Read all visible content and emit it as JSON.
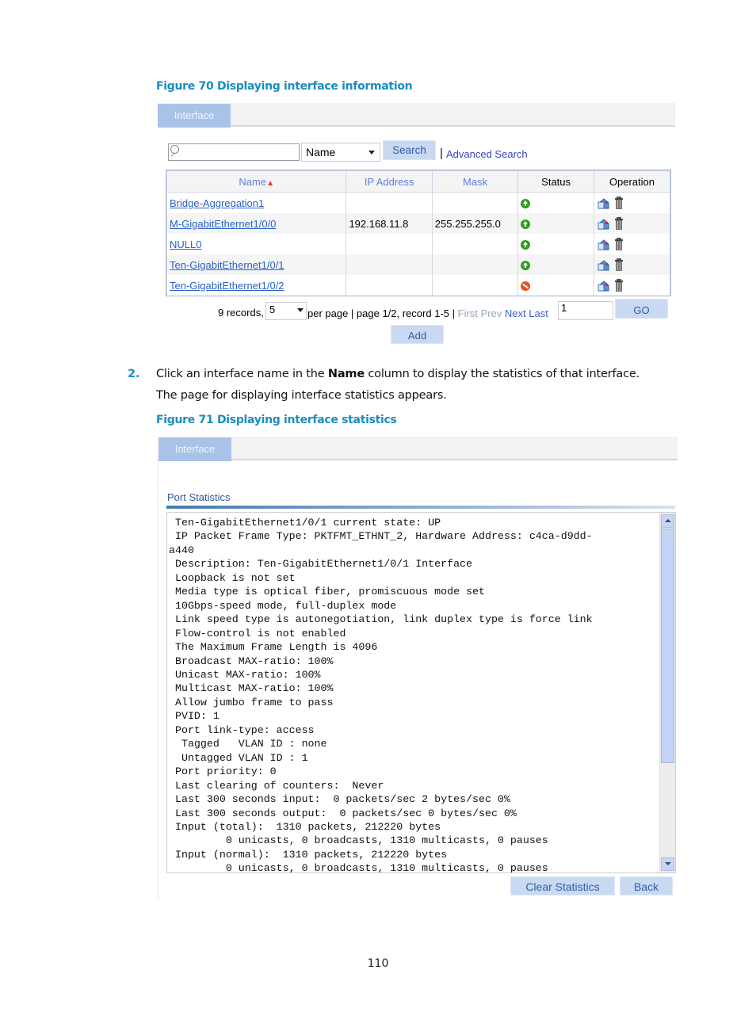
{
  "figure70": {
    "caption": "Figure 70 Displaying interface information",
    "tab_label": "Interface",
    "search": {
      "value": "",
      "placeholder": "",
      "field_selected": "Name",
      "search_label": "Search",
      "separator": "|",
      "advanced_label": "Advanced Search"
    },
    "table": {
      "columns": [
        {
          "label": "Name",
          "sort": "ascending"
        },
        {
          "label": "IP Address"
        },
        {
          "label": "Mask"
        },
        {
          "label": "Status"
        },
        {
          "label": "Operation"
        }
      ],
      "rows": [
        {
          "name": "Bridge-Aggregation1",
          "ip": "",
          "mask": "",
          "status": "up"
        },
        {
          "name": "M-GigabitEthernet1/0/0",
          "ip": "192.168.11.8",
          "mask": "255.255.255.0",
          "status": "up"
        },
        {
          "name": "NULL0",
          "ip": "",
          "mask": "",
          "status": "up"
        },
        {
          "name": "Ten-GigabitEthernet1/0/1",
          "ip": "",
          "mask": "",
          "status": "up"
        },
        {
          "name": "Ten-GigabitEthernet1/0/2",
          "ip": "",
          "mask": "",
          "status": "down"
        }
      ],
      "status_colors": {
        "up": "#2f9e1f",
        "down": "#e3541c"
      }
    },
    "pagination": {
      "records_text": "9 records,",
      "per_page_value": "5",
      "per_page_text": "per page | page 1/2, record 1-5 |",
      "first": "First",
      "prev": "Prev",
      "next": "Next",
      "last": "Last",
      "page_input": "1",
      "go_label": "GO"
    },
    "add_label": "Add"
  },
  "step": {
    "number": "2.",
    "text_before": "Click an interface name in the ",
    "text_bold": "Name",
    "text_after": " column to display the statistics of that interface.",
    "result": "The page for displaying interface statistics appears."
  },
  "figure71": {
    "caption": "Figure 71 Displaying interface statistics",
    "tab_label": "Interface",
    "section_title": "Port Statistics",
    "stats_lines": [
      " Ten-GigabitEthernet1/0/1 current state: UP",
      " IP Packet Frame Type: PKTFMT_ETHNT_2, Hardware Address: c4ca-d9dd-",
      "a440",
      " Description: Ten-GigabitEthernet1/0/1 Interface",
      " Loopback is not set",
      " Media type is optical fiber, promiscuous mode set",
      " 10Gbps-speed mode, full-duplex mode",
      " Link speed type is autonegotiation, link duplex type is force link",
      " Flow-control is not enabled",
      " The Maximum Frame Length is 4096",
      " Broadcast MAX-ratio: 100%",
      " Unicast MAX-ratio: 100%",
      " Multicast MAX-ratio: 100%",
      " Allow jumbo frame to pass",
      " PVID: 1",
      " Port link-type: access",
      "  Tagged   VLAN ID : none",
      "  Untagged VLAN ID : 1",
      " Port priority: 0",
      " Last clearing of counters:  Never",
      " Last 300 seconds input:  0 packets/sec 2 bytes/sec 0%",
      " Last 300 seconds output:  0 packets/sec 0 bytes/sec 0%",
      " Input (total):  1310 packets, 212220 bytes",
      "         0 unicasts, 0 broadcasts, 1310 multicasts, 0 pauses",
      " Input (normal):  1310 packets, 212220 bytes",
      "         0 unicasts, 0 broadcasts, 1310 multicasts, 0 pauses"
    ],
    "clear_label": "Clear Statistics",
    "back_label": "Back"
  },
  "page_number": "110"
}
